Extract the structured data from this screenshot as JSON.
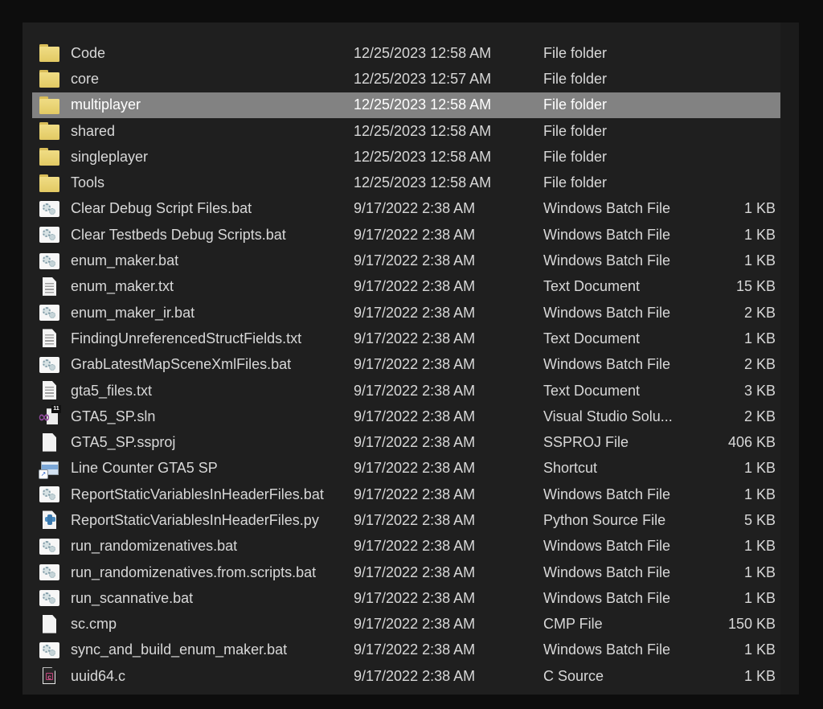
{
  "view": {
    "kind": "file-explorer-details-list",
    "selected_row": "multiplayer"
  },
  "colors": {
    "outer_background": "#0d0d0d",
    "panel_background": "#1f1f1f",
    "selection_background": "#828282",
    "text": "#d8d8d8",
    "folder_yellow": "#ecd573"
  },
  "rows": [
    {
      "name": "Code",
      "date": "12/25/2023 12:58 AM",
      "type": "File folder",
      "size": "",
      "icon": "folder",
      "selected": false
    },
    {
      "name": "core",
      "date": "12/25/2023 12:57 AM",
      "type": "File folder",
      "size": "",
      "icon": "folder",
      "selected": false
    },
    {
      "name": "multiplayer",
      "date": "12/25/2023 12:58 AM",
      "type": "File folder",
      "size": "",
      "icon": "folder",
      "selected": true
    },
    {
      "name": "shared",
      "date": "12/25/2023 12:58 AM",
      "type": "File folder",
      "size": "",
      "icon": "folder",
      "selected": false
    },
    {
      "name": "singleplayer",
      "date": "12/25/2023 12:58 AM",
      "type": "File folder",
      "size": "",
      "icon": "folder",
      "selected": false
    },
    {
      "name": "Tools",
      "date": "12/25/2023 12:58 AM",
      "type": "File folder",
      "size": "",
      "icon": "folder",
      "selected": false
    },
    {
      "name": "Clear Debug Script Files.bat",
      "date": "9/17/2022 2:38 AM",
      "type": "Windows Batch File",
      "size": "1 KB",
      "icon": "windows-batch",
      "selected": false
    },
    {
      "name": "Clear Testbeds Debug Scripts.bat",
      "date": "9/17/2022 2:38 AM",
      "type": "Windows Batch File",
      "size": "1 KB",
      "icon": "windows-batch",
      "selected": false
    },
    {
      "name": "enum_maker.bat",
      "date": "9/17/2022 2:38 AM",
      "type": "Windows Batch File",
      "size": "1 KB",
      "icon": "windows-batch",
      "selected": false
    },
    {
      "name": "enum_maker.txt",
      "date": "9/17/2022 2:38 AM",
      "type": "Text Document",
      "size": "15 KB",
      "icon": "text-document",
      "selected": false
    },
    {
      "name": "enum_maker_ir.bat",
      "date": "9/17/2022 2:38 AM",
      "type": "Windows Batch File",
      "size": "2 KB",
      "icon": "windows-batch",
      "selected": false
    },
    {
      "name": "FindingUnreferencedStructFields.txt",
      "date": "9/17/2022 2:38 AM",
      "type": "Text Document",
      "size": "1 KB",
      "icon": "text-document",
      "selected": false
    },
    {
      "name": "GrabLatestMapSceneXmlFiles.bat",
      "date": "9/17/2022 2:38 AM",
      "type": "Windows Batch File",
      "size": "2 KB",
      "icon": "windows-batch",
      "selected": false
    },
    {
      "name": "gta5_files.txt",
      "date": "9/17/2022 2:38 AM",
      "type": "Text Document",
      "size": "3 KB",
      "icon": "text-document",
      "selected": false
    },
    {
      "name": "GTA5_SP.sln",
      "date": "9/17/2022 2:38 AM",
      "type": "Visual Studio Solu...",
      "size": "2 KB",
      "icon": "visual-studio-solution",
      "badge": "11",
      "selected": false
    },
    {
      "name": "GTA5_SP.ssproj",
      "date": "9/17/2022 2:38 AM",
      "type": "SSPROJ File",
      "size": "406 KB",
      "icon": "generic-file",
      "selected": false
    },
    {
      "name": "Line Counter GTA5 SP",
      "date": "9/17/2022 2:38 AM",
      "type": "Shortcut",
      "size": "1 KB",
      "icon": "shortcut",
      "selected": false
    },
    {
      "name": "ReportStaticVariablesInHeaderFiles.bat",
      "date": "9/17/2022 2:38 AM",
      "type": "Windows Batch File",
      "size": "1 KB",
      "icon": "windows-batch",
      "selected": false
    },
    {
      "name": "ReportStaticVariablesInHeaderFiles.py",
      "date": "9/17/2022 2:38 AM",
      "type": "Python Source File",
      "size": "5 KB",
      "icon": "python",
      "selected": false
    },
    {
      "name": "run_randomizenatives.bat",
      "date": "9/17/2022 2:38 AM",
      "type": "Windows Batch File",
      "size": "1 KB",
      "icon": "windows-batch",
      "selected": false
    },
    {
      "name": "run_randomizenatives.from.scripts.bat",
      "date": "9/17/2022 2:38 AM",
      "type": "Windows Batch File",
      "size": "1 KB",
      "icon": "windows-batch",
      "selected": false
    },
    {
      "name": "run_scannative.bat",
      "date": "9/17/2022 2:38 AM",
      "type": "Windows Batch File",
      "size": "1 KB",
      "icon": "windows-batch",
      "selected": false
    },
    {
      "name": "sc.cmp",
      "date": "9/17/2022 2:38 AM",
      "type": "CMP File",
      "size": "150 KB",
      "icon": "generic-file",
      "selected": false
    },
    {
      "name": "sync_and_build_enum_maker.bat",
      "date": "9/17/2022 2:38 AM",
      "type": "Windows Batch File",
      "size": "1 KB",
      "icon": "windows-batch",
      "selected": false
    },
    {
      "name": "uuid64.c",
      "date": "9/17/2022 2:38 AM",
      "type": "C Source",
      "size": "1 KB",
      "icon": "c-source",
      "selected": false
    }
  ]
}
